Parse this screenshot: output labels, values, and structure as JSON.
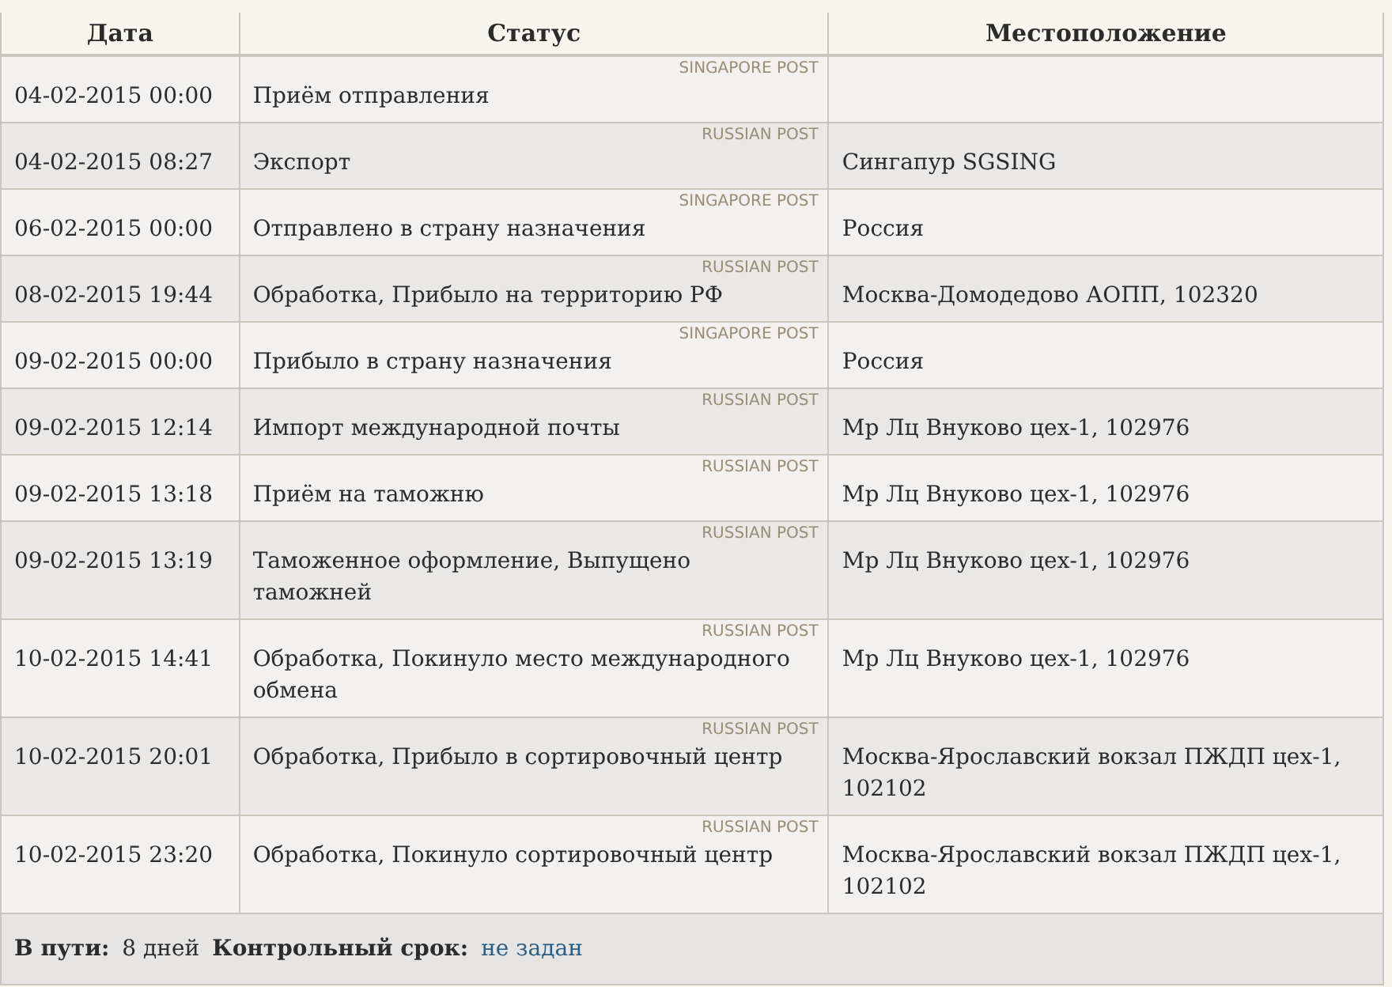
{
  "columns": [
    "Дата",
    "Статус",
    "Местоположение"
  ],
  "rows": [
    {
      "date": "04-02-2015 00:00",
      "carrier": "SINGAPORE POST",
      "status": "Приём отправления",
      "location": ""
    },
    {
      "date": "04-02-2015 08:27",
      "carrier": "RUSSIAN POST",
      "status": "Экспорт",
      "location": "Сингапур SGSING"
    },
    {
      "date": "06-02-2015 00:00",
      "carrier": "SINGAPORE POST",
      "status": "Отправлено в страну назначения",
      "location": "Россия"
    },
    {
      "date": "08-02-2015 19:44",
      "carrier": "RUSSIAN POST",
      "status": "Обработка, Прибыло на территорию РФ",
      "location": "Москва-Домодедово АОПП, 102320"
    },
    {
      "date": "09-02-2015 00:00",
      "carrier": "SINGAPORE POST",
      "status": "Прибыло в страну назначения",
      "location": "Россия"
    },
    {
      "date": "09-02-2015 12:14",
      "carrier": "RUSSIAN POST",
      "status": "Импорт международной почты",
      "location": "Мр Лц Внуково цех-1, 102976"
    },
    {
      "date": "09-02-2015 13:18",
      "carrier": "RUSSIAN POST",
      "status": "Приём на таможню",
      "location": "Мр Лц Внуково цех-1, 102976"
    },
    {
      "date": "09-02-2015 13:19",
      "carrier": "RUSSIAN POST",
      "status": "Таможенное оформление, Выпущено таможней",
      "location": "Мр Лц Внуково цех-1, 102976"
    },
    {
      "date": "10-02-2015 14:41",
      "carrier": "RUSSIAN POST",
      "status": "Обработка, Покинуло место международного обмена",
      "location": "Мр Лц Внуково цех-1, 102976"
    },
    {
      "date": "10-02-2015 20:01",
      "carrier": "RUSSIAN POST",
      "status": "Обработка, Прибыло в сортировочный центр",
      "location": "Москва-Ярославский вокзал ПЖДП цех-1, 102102"
    },
    {
      "date": "10-02-2015 23:20",
      "carrier": "RUSSIAN POST",
      "status": "Обработка, Покинуло сортировочный центр",
      "location": "Москва-Ярославский вокзал ПЖДП цех-1, 102102"
    }
  ],
  "footer": {
    "transit_label": "В пути:",
    "transit_value": "8 дней",
    "deadline_label": "Контрольный срок:",
    "deadline_link": "не задан"
  }
}
